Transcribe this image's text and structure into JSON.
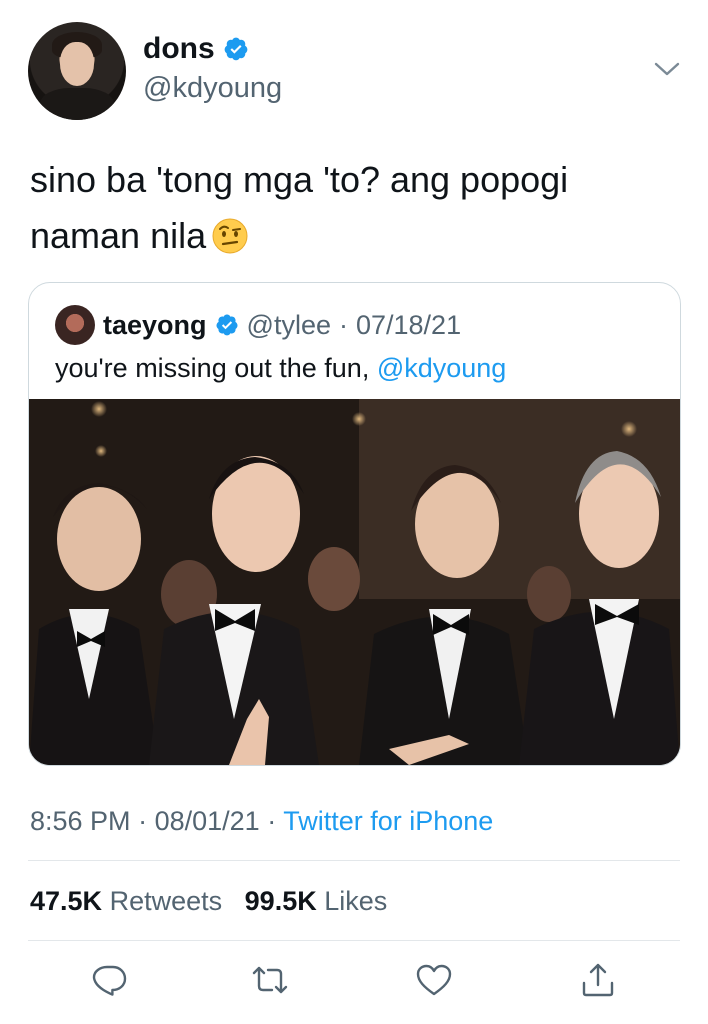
{
  "tweet": {
    "author_name": "dons",
    "author_handle": "@kdyoung",
    "text_line1": "sino ba 'tong mga 'to? ang popogi",
    "text_line2": "naman nila",
    "emoji_name": "face-with-raised-eyebrow"
  },
  "quoted": {
    "author_name": "taeyong",
    "author_handle": "@tylee",
    "separator": "·",
    "date": "07/18/21",
    "text": "you're missing out the fun, ",
    "mention": "@kdyoung"
  },
  "meta": {
    "time": "8:56 PM",
    "separator": "·",
    "date": "08/01/21",
    "separator2": "·",
    "source": "Twitter for iPhone"
  },
  "stats": {
    "retweets_count": "47.5K",
    "retweets_label": "Retweets",
    "likes_count": "99.5K",
    "likes_label": "Likes"
  },
  "colors": {
    "accent": "#1d9bf0",
    "muted": "#536471",
    "text": "#0f1419",
    "border": "#cfd9de"
  },
  "icons": [
    "verified-badge-icon",
    "chevron-down-icon",
    "reply-icon",
    "retweet-icon",
    "like-icon",
    "share-icon"
  ]
}
